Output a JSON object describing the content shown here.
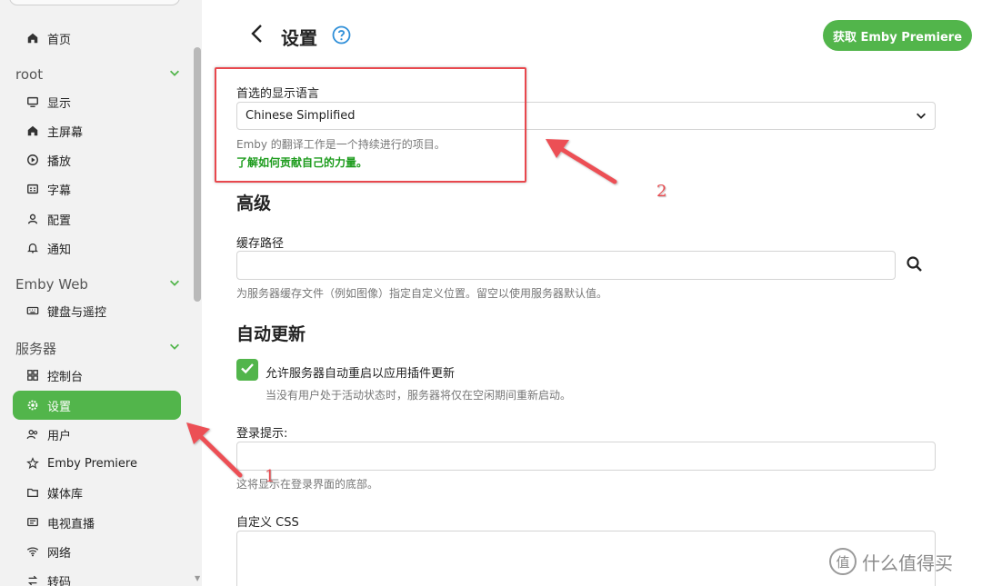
{
  "sidebar": {
    "items": [
      {
        "label": "首页",
        "icon": "home-icon"
      },
      {
        "label": "显示",
        "icon": "monitor-icon"
      },
      {
        "label": "主屏幕",
        "icon": "home-icon"
      },
      {
        "label": "播放",
        "icon": "play-circle-icon"
      },
      {
        "label": "字幕",
        "icon": "subtitles-icon"
      },
      {
        "label": "配置",
        "icon": "person-icon"
      },
      {
        "label": "通知",
        "icon": "bell-icon"
      },
      {
        "label": "键盘与遥控",
        "icon": "keyboard-icon"
      },
      {
        "label": "控制台",
        "icon": "dashboard-icon"
      },
      {
        "label": "设置",
        "icon": "gear-icon"
      },
      {
        "label": "用户",
        "icon": "people-icon"
      },
      {
        "label": "Emby Premiere",
        "icon": "star-icon"
      },
      {
        "label": "媒体库",
        "icon": "folder-icon"
      },
      {
        "label": "电视直播",
        "icon": "tv-icon"
      },
      {
        "label": "网络",
        "icon": "wifi-icon"
      },
      {
        "label": "转码",
        "icon": "transcode-icon"
      }
    ],
    "sections": [
      "root",
      "Emby Web",
      "服务器"
    ],
    "active_item": "设置",
    "accent_color": "#52b54b"
  },
  "header": {
    "title": "设置",
    "premiere_button": "获取 Emby Premiere"
  },
  "language": {
    "label": "首选的显示语言",
    "value": "Chinese Simplified",
    "help": "Emby 的翻译工作是一个持续进行的项目。",
    "link": "了解如何贡献自己的力量。"
  },
  "advanced": {
    "title": "高级",
    "cache_label": "缓存路径",
    "cache_value": "",
    "cache_help": "为服务器缓存文件（例如图像）指定自定义位置。留空以使用服务器默认值。"
  },
  "autoupdate": {
    "title": "自动更新",
    "checkbox_label": "允许服务器自动重启以应用插件更新",
    "checkbox_checked": true,
    "help": "当没有用户处于活动状态时，服务器将仅在空闲期间重新启动。"
  },
  "login": {
    "label": "登录提示:",
    "value": "",
    "help": "这将显示在登录界面的底部。"
  },
  "custom_css": {
    "label": "自定义 CSS",
    "value": ""
  },
  "annotations": {
    "one": "1",
    "two": "2",
    "color": "#e8484d"
  },
  "watermark": {
    "logo_char": "值",
    "text": "什么值得买"
  }
}
